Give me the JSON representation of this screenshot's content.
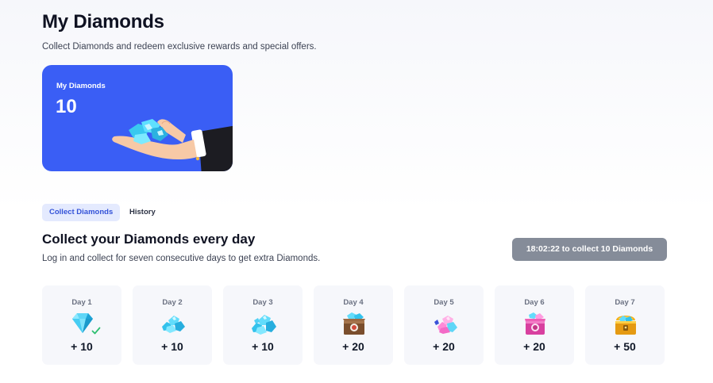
{
  "header": {
    "title": "My Diamonds",
    "subtitle": "Collect Diamonds and redeem exclusive rewards and special offers."
  },
  "balance": {
    "label": "My Diamonds",
    "value": "10",
    "card_color": "#3a5ef5",
    "illustration": "hand-holding-diamonds-icon"
  },
  "tabs": [
    {
      "label": "Collect Diamonds",
      "active": true
    },
    {
      "label": "History",
      "active": false
    }
  ],
  "collect": {
    "title": "Collect your Diamonds every day",
    "subtitle": "Log in and collect for seven consecutive days to get extra Diamonds.",
    "button_label": "18:02:22 to collect 10 Diamonds",
    "button_color": "#858c99"
  },
  "days": [
    {
      "label": "Day 1",
      "amount": "+ 10",
      "icon": "single-diamond-icon",
      "collected": true
    },
    {
      "label": "Day 2",
      "amount": "+ 10",
      "icon": "diamond-pile-icon",
      "collected": false
    },
    {
      "label": "Day 3",
      "amount": "+ 10",
      "icon": "diamond-pile-icon",
      "collected": false
    },
    {
      "label": "Day 4",
      "amount": "+ 20",
      "icon": "diamond-crate-icon",
      "collected": false
    },
    {
      "label": "Day 5",
      "amount": "+ 20",
      "icon": "pink-diamond-pile-icon",
      "collected": false
    },
    {
      "label": "Day 6",
      "amount": "+ 20",
      "icon": "pink-diamond-box-icon",
      "collected": false
    },
    {
      "label": "Day 7",
      "amount": "+ 50",
      "icon": "treasure-chest-icon",
      "collected": false
    }
  ]
}
